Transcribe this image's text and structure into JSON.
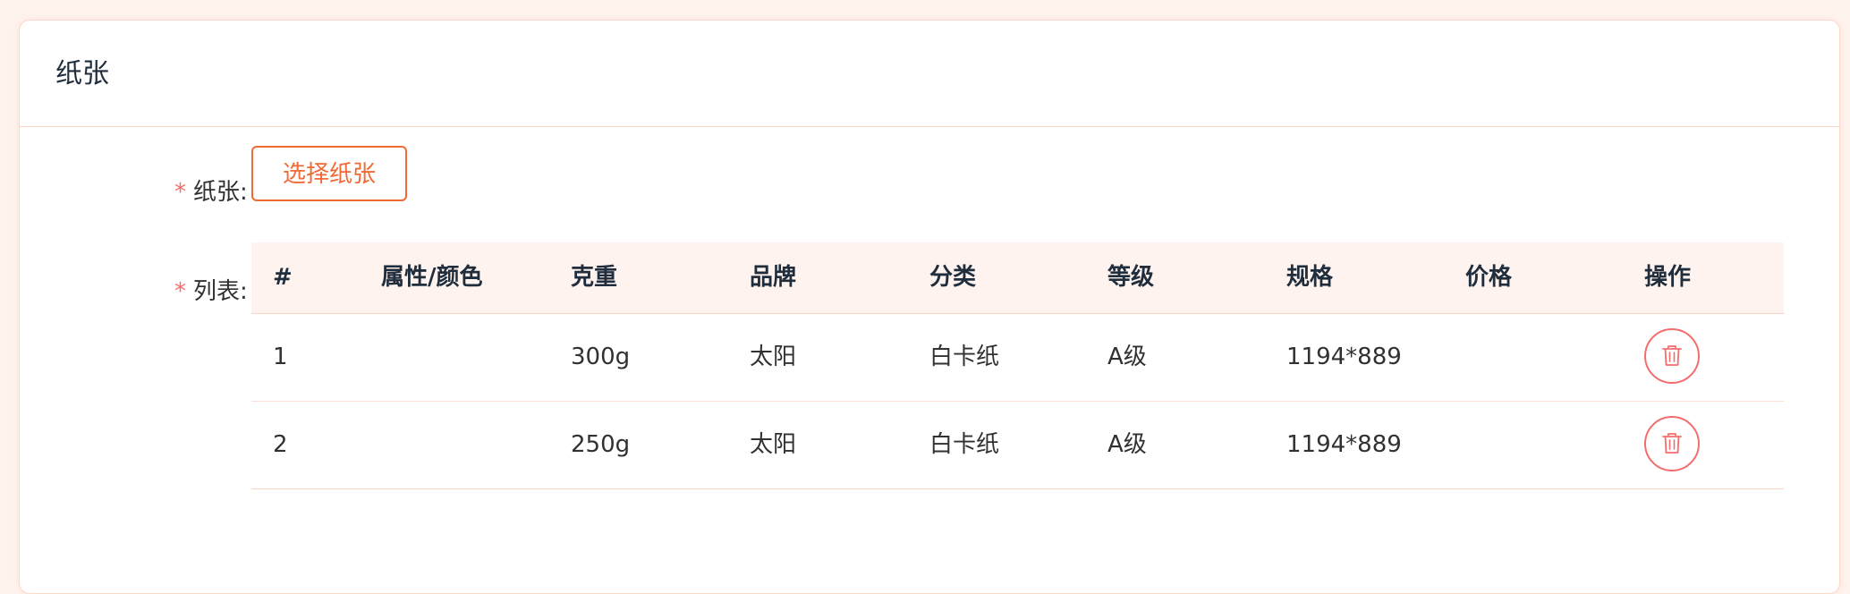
{
  "card": {
    "title": "纸张"
  },
  "form": {
    "paper_label": "纸张:",
    "list_label": "列表:",
    "required_mark": "*",
    "select_button_label": "选择纸张"
  },
  "table": {
    "headers": [
      "#",
      "属性/颜色",
      "克重",
      "品牌",
      "分类",
      "等级",
      "规格",
      "价格",
      "操作"
    ],
    "rows": [
      {
        "index": "1",
        "attr_color": "",
        "weight": "300g",
        "brand": "太阳",
        "category": "白卡纸",
        "grade": "A级",
        "size": "1194*889",
        "price": ""
      },
      {
        "index": "2",
        "attr_color": "",
        "weight": "250g",
        "brand": "太阳",
        "category": "白卡纸",
        "grade": "A级",
        "size": "1194*889",
        "price": ""
      }
    ],
    "action_icon": "trash-icon"
  },
  "colors": {
    "accent": "#f06a35",
    "danger": "#f56c6c",
    "page_background": "#fff3ee",
    "header_background": "#fef3ee",
    "border": "#fbd3c0"
  }
}
